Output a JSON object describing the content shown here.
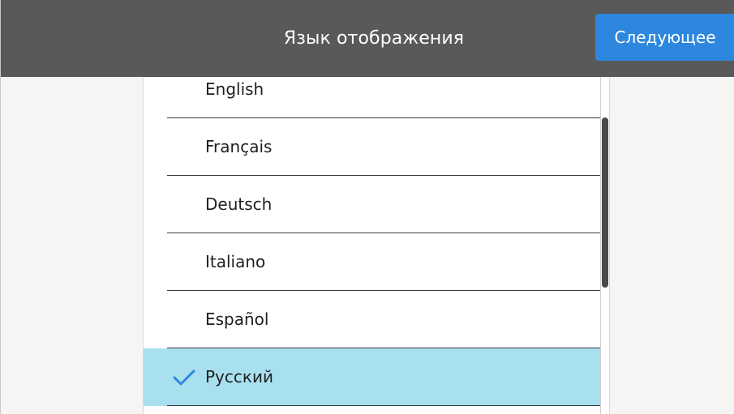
{
  "header": {
    "title": "Язык отображения",
    "next_label": "Следующее"
  },
  "languages": [
    {
      "label": "English",
      "selected": false
    },
    {
      "label": "Français",
      "selected": false
    },
    {
      "label": "Deutsch",
      "selected": false
    },
    {
      "label": "Italiano",
      "selected": false
    },
    {
      "label": "Español",
      "selected": false
    },
    {
      "label": "Русский",
      "selected": true
    }
  ],
  "colors": {
    "header_bg": "#595959",
    "accent": "#2d87de",
    "selected_row": "#a8e0f0"
  },
  "icons": {
    "selected_marker": "checkmark-icon"
  }
}
